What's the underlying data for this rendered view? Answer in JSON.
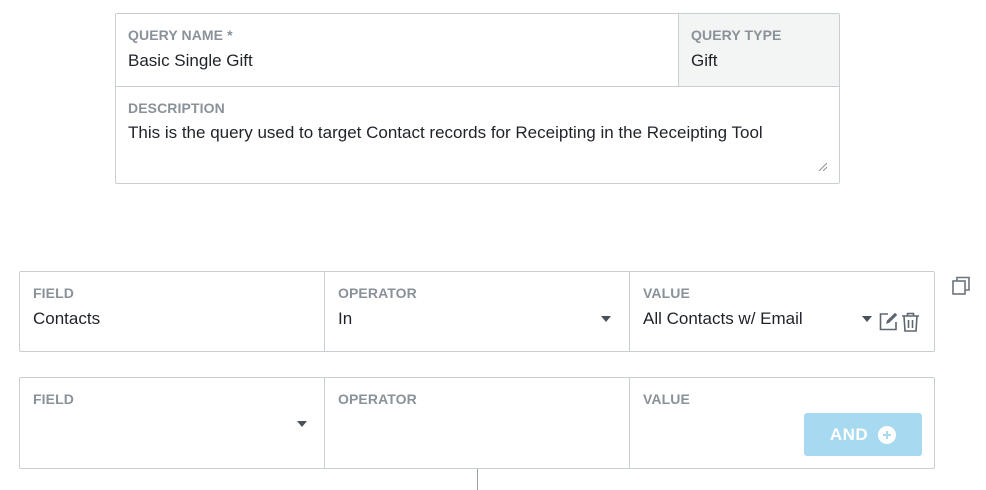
{
  "query": {
    "name_label": "QUERY NAME *",
    "name_value": "Basic Single Gift",
    "type_label": "QUERY TYPE",
    "type_value": "Gift",
    "description_label": "DESCRIPTION",
    "description_value": "This is the query used to target Contact records for Receipting in the Receipting Tool"
  },
  "conditions": [
    {
      "field_label": "FIELD",
      "field_value": "Contacts",
      "operator_label": "OPERATOR",
      "operator_value": "In",
      "value_label": "VALUE",
      "value_value": "All Contacts w/ Email"
    },
    {
      "field_label": "FIELD",
      "field_value": "",
      "operator_label": "OPERATOR",
      "operator_value": "",
      "value_label": "VALUE",
      "value_value": "",
      "and_button_label": "AND"
    }
  ],
  "icons": {
    "copy": "copy-icon",
    "edit": "edit-icon",
    "delete": "trash-icon",
    "dropdown": "chevron-down-icon",
    "add": "plus-circle-icon"
  },
  "colors": {
    "border": "#c9ced3",
    "label": "#8a9299",
    "and_button": "#a7daf0",
    "readonly_bg": "#f3f4f4"
  }
}
